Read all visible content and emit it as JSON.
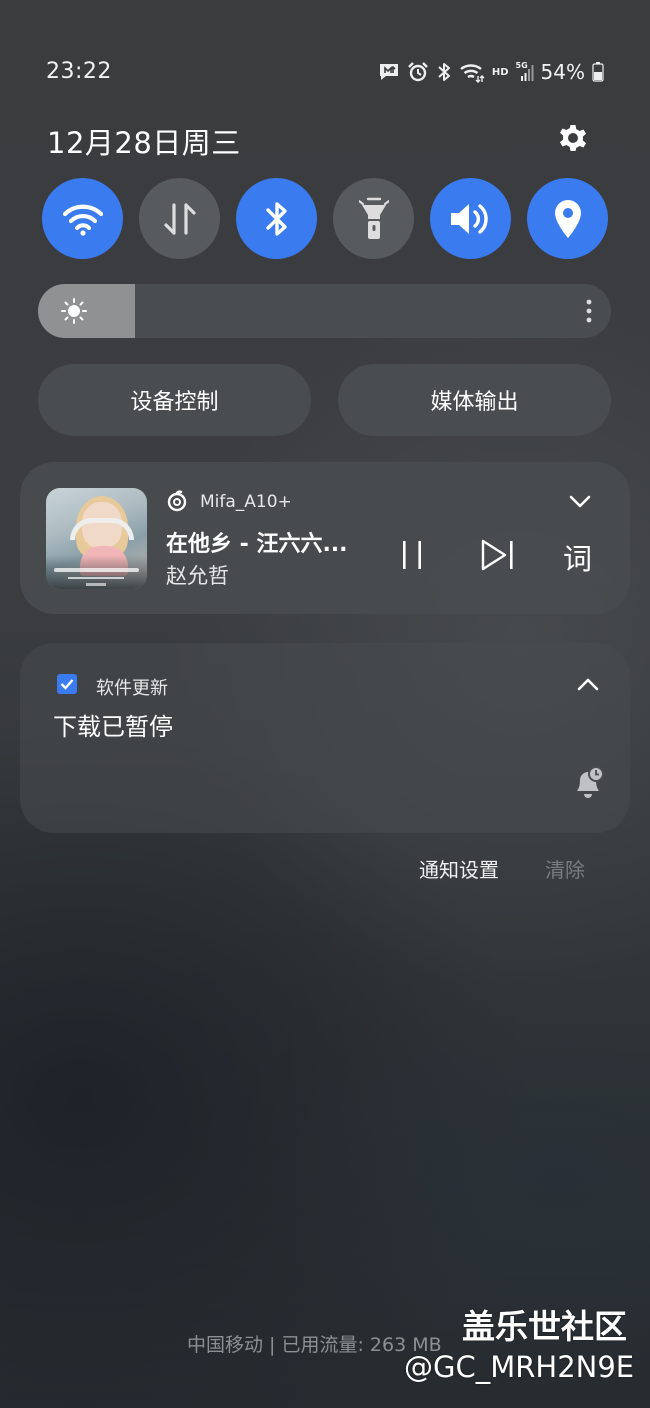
{
  "status_bar": {
    "time": "23:22",
    "icons": [
      "message-icon",
      "alarm-icon",
      "bluetooth-icon",
      "wifi-icon",
      "hd-icon",
      "signal-5g-icon",
      "battery-icon"
    ],
    "hd_label": "HD",
    "network_label": "5G",
    "battery_percent": "54%",
    "battery_level": 0.54
  },
  "header": {
    "date": "12月28日周三",
    "settings_icon": "gear-icon"
  },
  "quick_toggles": [
    {
      "name": "wifi",
      "icon": "wifi-icon",
      "active": true
    },
    {
      "name": "mobile-data",
      "icon": "data-arrows-icon",
      "active": false
    },
    {
      "name": "bluetooth",
      "icon": "bluetooth-icon",
      "active": true
    },
    {
      "name": "flashlight",
      "icon": "flashlight-icon",
      "active": false
    },
    {
      "name": "sound",
      "icon": "speaker-icon",
      "active": true
    },
    {
      "name": "location",
      "icon": "location-pin-icon",
      "active": true
    }
  ],
  "brightness": {
    "level": 0.17,
    "icon": "sun-icon"
  },
  "pill_buttons": {
    "device_control": "设备控制",
    "media_output": "媒体输出"
  },
  "media_player": {
    "app_name": "Mifa_A10+",
    "title": "在他乡 - 汪六六...",
    "artist": "赵允哲",
    "lyrics_label": "词",
    "playing": true
  },
  "update_notification": {
    "app_name": "软件更新",
    "title": "下载已暂停"
  },
  "notification_actions": {
    "settings": "通知设置",
    "clear": "清除"
  },
  "footer": {
    "carrier": "中国移动 | 已用流量: 263 MB"
  },
  "watermark": {
    "site": "盖乐世社区",
    "user": "@GC_MRH2N9E"
  },
  "colors": {
    "accent": "#3a7bf0",
    "toggle_off": "#585b5e",
    "pill_bg": "#4a4d50",
    "clear_disabled": "#7a7d80"
  }
}
